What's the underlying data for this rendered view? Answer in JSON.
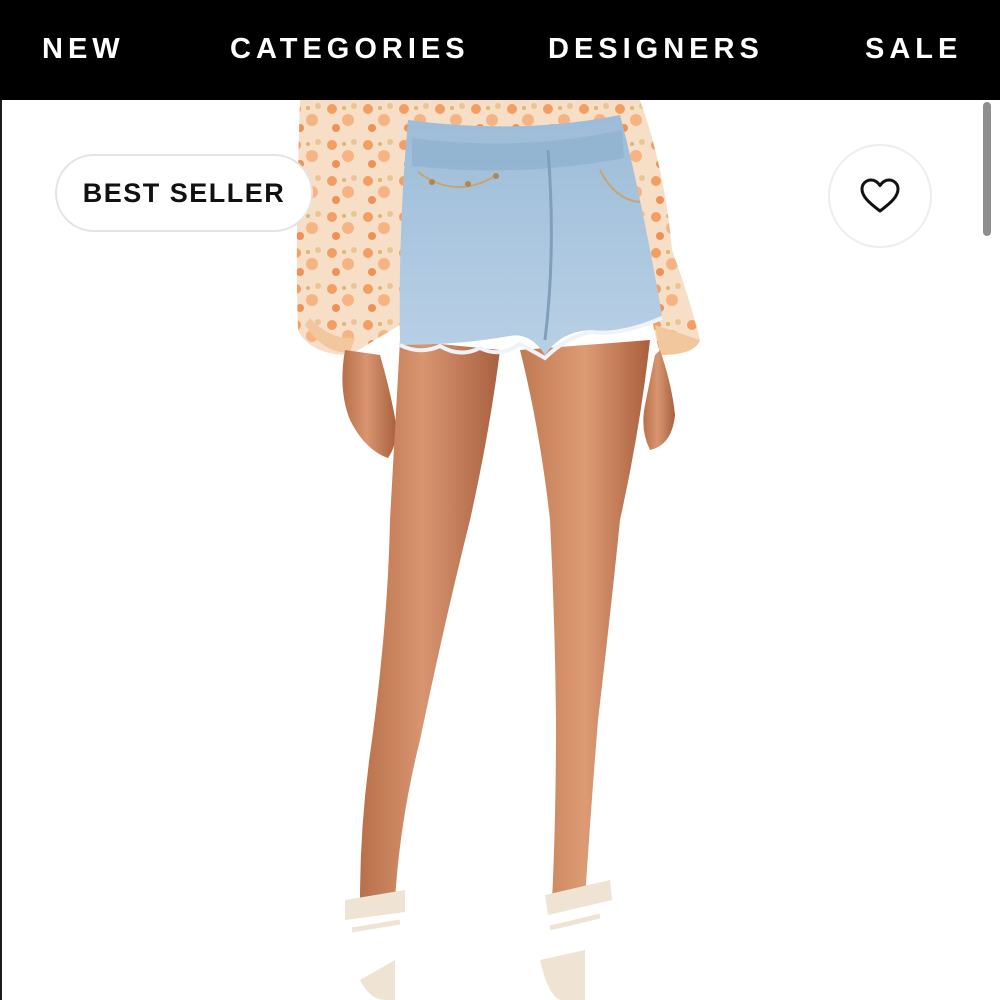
{
  "nav": {
    "items": [
      {
        "label": "NEW"
      },
      {
        "label": "CATEGORIES"
      },
      {
        "label": "DESIGNERS"
      },
      {
        "label": "SALE"
      }
    ]
  },
  "product": {
    "badge_label": "BEST SELLER",
    "wishlist_icon": "heart-icon",
    "image_subject": "model wearing light-wash denim cutoff shorts with floral blouse and lace-up heels"
  },
  "colors": {
    "nav_background": "#000000",
    "nav_text": "#ffffff",
    "badge_text": "#111111",
    "denim": "#a9c6df",
    "blouse_floral": "#f1a06a"
  }
}
